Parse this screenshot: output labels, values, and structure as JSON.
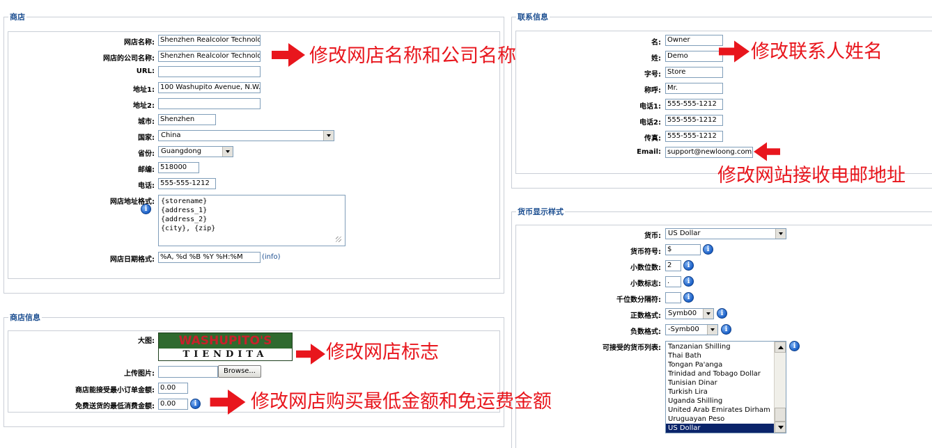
{
  "store": {
    "legend": "商店",
    "name_label": "网店名称:",
    "name_value": "Shenzhen Realcolor Technolog",
    "company_label": "网店的公司名称:",
    "company_value": "Shenzhen Realcolor Technolog",
    "url_label": "URL:",
    "url_value": "",
    "address1_label": "地址1:",
    "address1_value": "100 Washupito Avenue, N.W.",
    "address2_label": "地址2:",
    "address2_value": "",
    "city_label": "城市:",
    "city_value": "Shenzhen",
    "country_label": "国家:",
    "country_value": "China",
    "province_label": "省份:",
    "province_value": "Guangdong",
    "zip_label": "邮编:",
    "zip_value": "518000",
    "phone_label": "电话:",
    "phone_value": "555-555-1212",
    "address_format_label": "网店地址格式:",
    "address_format_value": "{storename}\n{address_1}\n{address_2}\n{city}, {zip}",
    "date_format_label": "网店日期格式:",
    "date_format_value": "%A, %d %B %Y %H:%M",
    "date_info_link": "(info)"
  },
  "store_info": {
    "legend": "商店信息",
    "logo_label": "大图:",
    "logo_text_top": "WASHUPITO'S",
    "logo_text_bottom": "TIENDITA",
    "upload_label": "上传图片:",
    "upload_value": "",
    "browse_label": "Browse...",
    "min_order_label": "商店能接受最小订单金额:",
    "min_order_value": "0.00",
    "free_ship_label": "免费送货的最低消费金额:",
    "free_ship_value": "0.00"
  },
  "contact": {
    "legend": "联系信息",
    "first_label": "名:",
    "first_value": "Owner",
    "last_label": "姓:",
    "last_value": "Demo",
    "middle_label": "字号:",
    "middle_value": "Store",
    "title_label": "称呼:",
    "title_value": "Mr.",
    "phone1_label": "电话1:",
    "phone1_value": "555-555-1212",
    "phone2_label": "电话2:",
    "phone2_value": "555-555-1212",
    "fax_label": "传真:",
    "fax_value": "555-555-1212",
    "email_label": "Email:",
    "email_value": "support@newloong.com"
  },
  "currency": {
    "legend": "货币显示样式",
    "currency_label": "货币:",
    "currency_value": "US Dollar",
    "symbol_label": "货币符号:",
    "symbol_value": "$",
    "decimals_label": "小数位数:",
    "decimals_value": "2",
    "decimal_sep_label": "小数标志:",
    "decimal_sep_value": ".",
    "thousands_label": "千位数分隔符:",
    "thousands_value": "",
    "positive_label": "正数格式:",
    "positive_value": "Symb00",
    "negative_label": "负数格式:",
    "negative_value": "-Symb00",
    "accepted_label": "可接受的货币列表:",
    "accepted_list": [
      "Tanzanian Shilling",
      "Thai Bath",
      "Tongan Pa'anga",
      "Trinidad and Tobago Dollar",
      "Tunisian Dinar",
      "Turkish Lira",
      "Uganda Shilling",
      "United Arab Emirates Dirham",
      "Uruguayan Peso",
      "US Dollar"
    ]
  },
  "annotations": {
    "store_names": "修改网店名称和公司名称",
    "contact_name": "修改联系人姓名",
    "email": "修改网站接收电邮地址",
    "logo": "修改网店标志",
    "amounts": "修改网店购买最低金额和免运费金额"
  },
  "colors": {
    "legend_text": "#1d4f91",
    "annotation_red": "#e8161d",
    "selected_option": "#0a246a"
  },
  "info_icon_glyph": "i"
}
